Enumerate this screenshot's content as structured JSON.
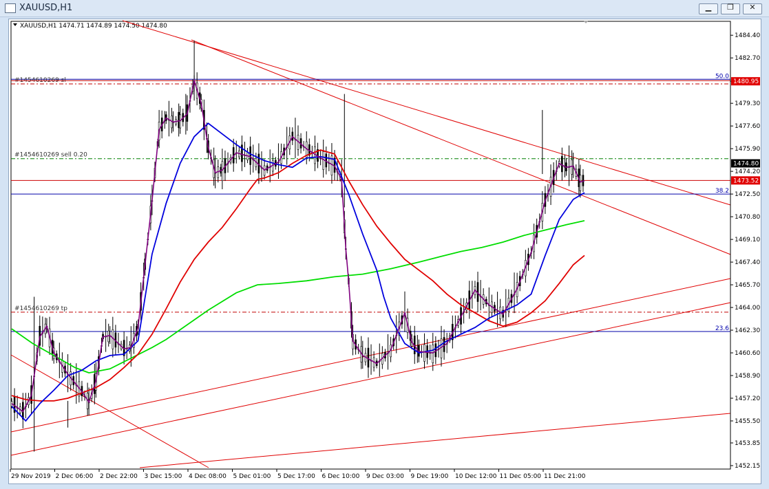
{
  "window": {
    "title": "XAUUSD,H1"
  },
  "header": {
    "symbol": "XAUUSD,H1",
    "ohlc": "1474.71 1474.89 1474.50 1474.80"
  },
  "chart_data": {
    "type": "candlestick",
    "symbol": "XAUUSD",
    "timeframe": "H1",
    "ohlc_last": {
      "open": 1474.71,
      "high": 1474.89,
      "low": 1474.5,
      "close": 1474.8
    },
    "ylim": [
      1452.15,
      1485.7
    ],
    "y_ticks": [
      "1484.40",
      "1482.70",
      "1480.95",
      "1479.30",
      "1477.60",
      "1475.90",
      "1474.20",
      "1472.50",
      "1470.80",
      "1469.10",
      "1467.40",
      "1465.70",
      "1464.00",
      "1462.30",
      "1460.60",
      "1458.90",
      "1457.20",
      "1455.50",
      "1453.85",
      "1452.15"
    ],
    "x_ticks": [
      "29 Nov 2019",
      "2 Dec 06:00",
      "2 Dec 22:00",
      "3 Dec 15:00",
      "4 Dec 08:00",
      "5 Dec 01:00",
      "5 Dec 17:00",
      "6 Dec 10:00",
      "9 Dec 03:00",
      "9 Dec 19:00",
      "10 Dec 12:00",
      "11 Dec 05:00",
      "11 Dec 21:00"
    ],
    "price_markers": [
      {
        "label": "1480.95",
        "value": 1480.95,
        "color": "#e00000"
      },
      {
        "label": "1474.80",
        "value": 1474.8,
        "color": "#000000"
      },
      {
        "label": "1473.52",
        "value": 1473.52,
        "color": "#e00000"
      }
    ],
    "order_lines": [
      {
        "label": "#1454610269 sl",
        "value": 1480.75,
        "color": "#c00000"
      },
      {
        "label": "#1454610269 sell 0.20",
        "value": 1475.15,
        "color": "#008000"
      },
      {
        "label": "#1454610269 tp",
        "value": 1463.65,
        "color": "#c00000"
      }
    ],
    "fib_levels": [
      {
        "label": "50.0",
        "value": 1481.1,
        "color": "#0000aa"
      },
      {
        "label": "38.2",
        "value": 1472.5,
        "color": "#0000aa"
      },
      {
        "label": "23.6",
        "value": 1462.2,
        "color": "#0000aa"
      }
    ],
    "horizontal_line": {
      "value": 1473.52,
      "color": "#cc0000"
    },
    "series": [
      {
        "color": "#00dd00",
        "values": [
          [
            0,
            1462.4
          ],
          [
            15,
            1461.3
          ],
          [
            30,
            1460.4
          ],
          [
            45,
            1459.5
          ],
          [
            55,
            1459.1
          ],
          [
            70,
            1459.4
          ],
          [
            85,
            1460.2
          ],
          [
            100,
            1461.0
          ],
          [
            110,
            1461.6
          ],
          [
            125,
            1462.7
          ],
          [
            140,
            1463.8
          ],
          [
            160,
            1465.1
          ],
          [
            175,
            1465.7
          ],
          [
            190,
            1465.8
          ],
          [
            210,
            1466.0
          ],
          [
            230,
            1466.3
          ],
          [
            250,
            1466.5
          ],
          [
            270,
            1466.9
          ],
          [
            290,
            1467.4
          ],
          [
            305,
            1467.8
          ],
          [
            320,
            1468.2
          ],
          [
            335,
            1468.5
          ],
          [
            350,
            1468.9
          ],
          [
            365,
            1469.4
          ],
          [
            380,
            1469.8
          ],
          [
            395,
            1470.2
          ],
          [
            408,
            1470.5
          ]
        ]
      },
      {
        "color": "#e00000",
        "values": [
          [
            0,
            1457.4
          ],
          [
            10,
            1457.1
          ],
          [
            20,
            1457.0
          ],
          [
            30,
            1457.0
          ],
          [
            40,
            1457.2
          ],
          [
            50,
            1457.6
          ],
          [
            60,
            1458.0
          ],
          [
            70,
            1458.6
          ],
          [
            80,
            1459.5
          ],
          [
            90,
            1460.5
          ],
          [
            100,
            1462.0
          ],
          [
            110,
            1463.9
          ],
          [
            120,
            1465.9
          ],
          [
            130,
            1467.6
          ],
          [
            140,
            1468.9
          ],
          [
            150,
            1470.0
          ],
          [
            160,
            1471.4
          ],
          [
            170,
            1472.9
          ],
          [
            175,
            1473.6
          ],
          [
            180,
            1473.7
          ],
          [
            190,
            1474.1
          ],
          [
            200,
            1474.8
          ],
          [
            210,
            1475.4
          ],
          [
            220,
            1475.8
          ],
          [
            230,
            1475.5
          ],
          [
            240,
            1473.5
          ],
          [
            250,
            1471.7
          ],
          [
            260,
            1470.1
          ],
          [
            270,
            1468.8
          ],
          [
            280,
            1467.6
          ],
          [
            290,
            1466.8
          ],
          [
            300,
            1466.0
          ],
          [
            310,
            1465.0
          ],
          [
            320,
            1464.2
          ],
          [
            330,
            1463.6
          ],
          [
            340,
            1463.0
          ],
          [
            350,
            1462.6
          ],
          [
            360,
            1462.9
          ],
          [
            370,
            1463.6
          ],
          [
            380,
            1464.5
          ],
          [
            390,
            1465.8
          ],
          [
            400,
            1467.2
          ],
          [
            408,
            1467.9
          ]
        ]
      },
      {
        "color": "#0000dd",
        "values": [
          [
            0,
            1456.6
          ],
          [
            10,
            1455.5
          ],
          [
            20,
            1456.8
          ],
          [
            30,
            1457.8
          ],
          [
            40,
            1458.9
          ],
          [
            50,
            1459.3
          ],
          [
            60,
            1460.0
          ],
          [
            70,
            1460.4
          ],
          [
            80,
            1460.5
          ],
          [
            85,
            1461.0
          ],
          [
            90,
            1461.5
          ],
          [
            100,
            1468.0
          ],
          [
            110,
            1471.8
          ],
          [
            120,
            1474.8
          ],
          [
            130,
            1476.8
          ],
          [
            140,
            1477.8
          ],
          [
            150,
            1477.0
          ],
          [
            160,
            1476.2
          ],
          [
            170,
            1475.5
          ],
          [
            180,
            1475.0
          ],
          [
            190,
            1474.7
          ],
          [
            200,
            1474.5
          ],
          [
            210,
            1475.2
          ],
          [
            220,
            1475.3
          ],
          [
            230,
            1475.1
          ],
          [
            240,
            1472.5
          ],
          [
            250,
            1469.5
          ],
          [
            260,
            1466.8
          ],
          [
            265,
            1464.8
          ],
          [
            270,
            1463.2
          ],
          [
            280,
            1461.3
          ],
          [
            290,
            1460.6
          ],
          [
            300,
            1460.8
          ],
          [
            310,
            1461.5
          ],
          [
            320,
            1462.0
          ],
          [
            330,
            1462.5
          ],
          [
            340,
            1463.2
          ],
          [
            350,
            1463.7
          ],
          [
            360,
            1464.2
          ],
          [
            370,
            1465.0
          ],
          [
            380,
            1467.9
          ],
          [
            390,
            1470.6
          ],
          [
            400,
            1472.1
          ],
          [
            408,
            1472.6
          ]
        ]
      },
      {
        "color": "#800080",
        "values": [
          [
            0,
            1456.8
          ],
          [
            8,
            1456.2
          ],
          [
            14,
            1457.4
          ],
          [
            20,
            1461.8
          ],
          [
            25,
            1462.6
          ],
          [
            30,
            1460.6
          ],
          [
            40,
            1459.0
          ],
          [
            50,
            1457.7
          ],
          [
            55,
            1456.9
          ],
          [
            60,
            1458.5
          ],
          [
            65,
            1461.8
          ],
          [
            70,
            1461.9
          ],
          [
            80,
            1460.9
          ],
          [
            85,
            1461.0
          ],
          [
            90,
            1462.5
          ],
          [
            95,
            1467.2
          ],
          [
            100,
            1472.0
          ],
          [
            105,
            1477.3
          ],
          [
            110,
            1478.2
          ],
          [
            115,
            1477.9
          ],
          [
            120,
            1478.0
          ],
          [
            125,
            1478.5
          ],
          [
            130,
            1481.0
          ],
          [
            135,
            1479.3
          ],
          [
            140,
            1476.0
          ],
          [
            145,
            1474.1
          ],
          [
            150,
            1474.3
          ],
          [
            160,
            1475.6
          ],
          [
            170,
            1475.3
          ],
          [
            180,
            1474.3
          ],
          [
            190,
            1474.9
          ],
          [
            200,
            1476.8
          ],
          [
            210,
            1475.9
          ],
          [
            220,
            1475.2
          ],
          [
            230,
            1474.6
          ],
          [
            235,
            1473.6
          ],
          [
            238,
            1468.4
          ],
          [
            240,
            1466.0
          ],
          [
            243,
            1461.5
          ],
          [
            250,
            1460.4
          ],
          [
            260,
            1459.8
          ],
          [
            270,
            1460.8
          ],
          [
            280,
            1463.6
          ],
          [
            285,
            1461.4
          ],
          [
            290,
            1460.7
          ],
          [
            300,
            1460.6
          ],
          [
            310,
            1461.3
          ],
          [
            320,
            1463.3
          ],
          [
            330,
            1465.3
          ],
          [
            340,
            1464.2
          ],
          [
            350,
            1463.5
          ],
          [
            360,
            1465.4
          ],
          [
            370,
            1468.1
          ],
          [
            380,
            1472.0
          ],
          [
            390,
            1474.8
          ],
          [
            395,
            1474.5
          ],
          [
            400,
            1474.6
          ],
          [
            405,
            1473.4
          ],
          [
            408,
            1473.5
          ]
        ]
      }
    ]
  }
}
